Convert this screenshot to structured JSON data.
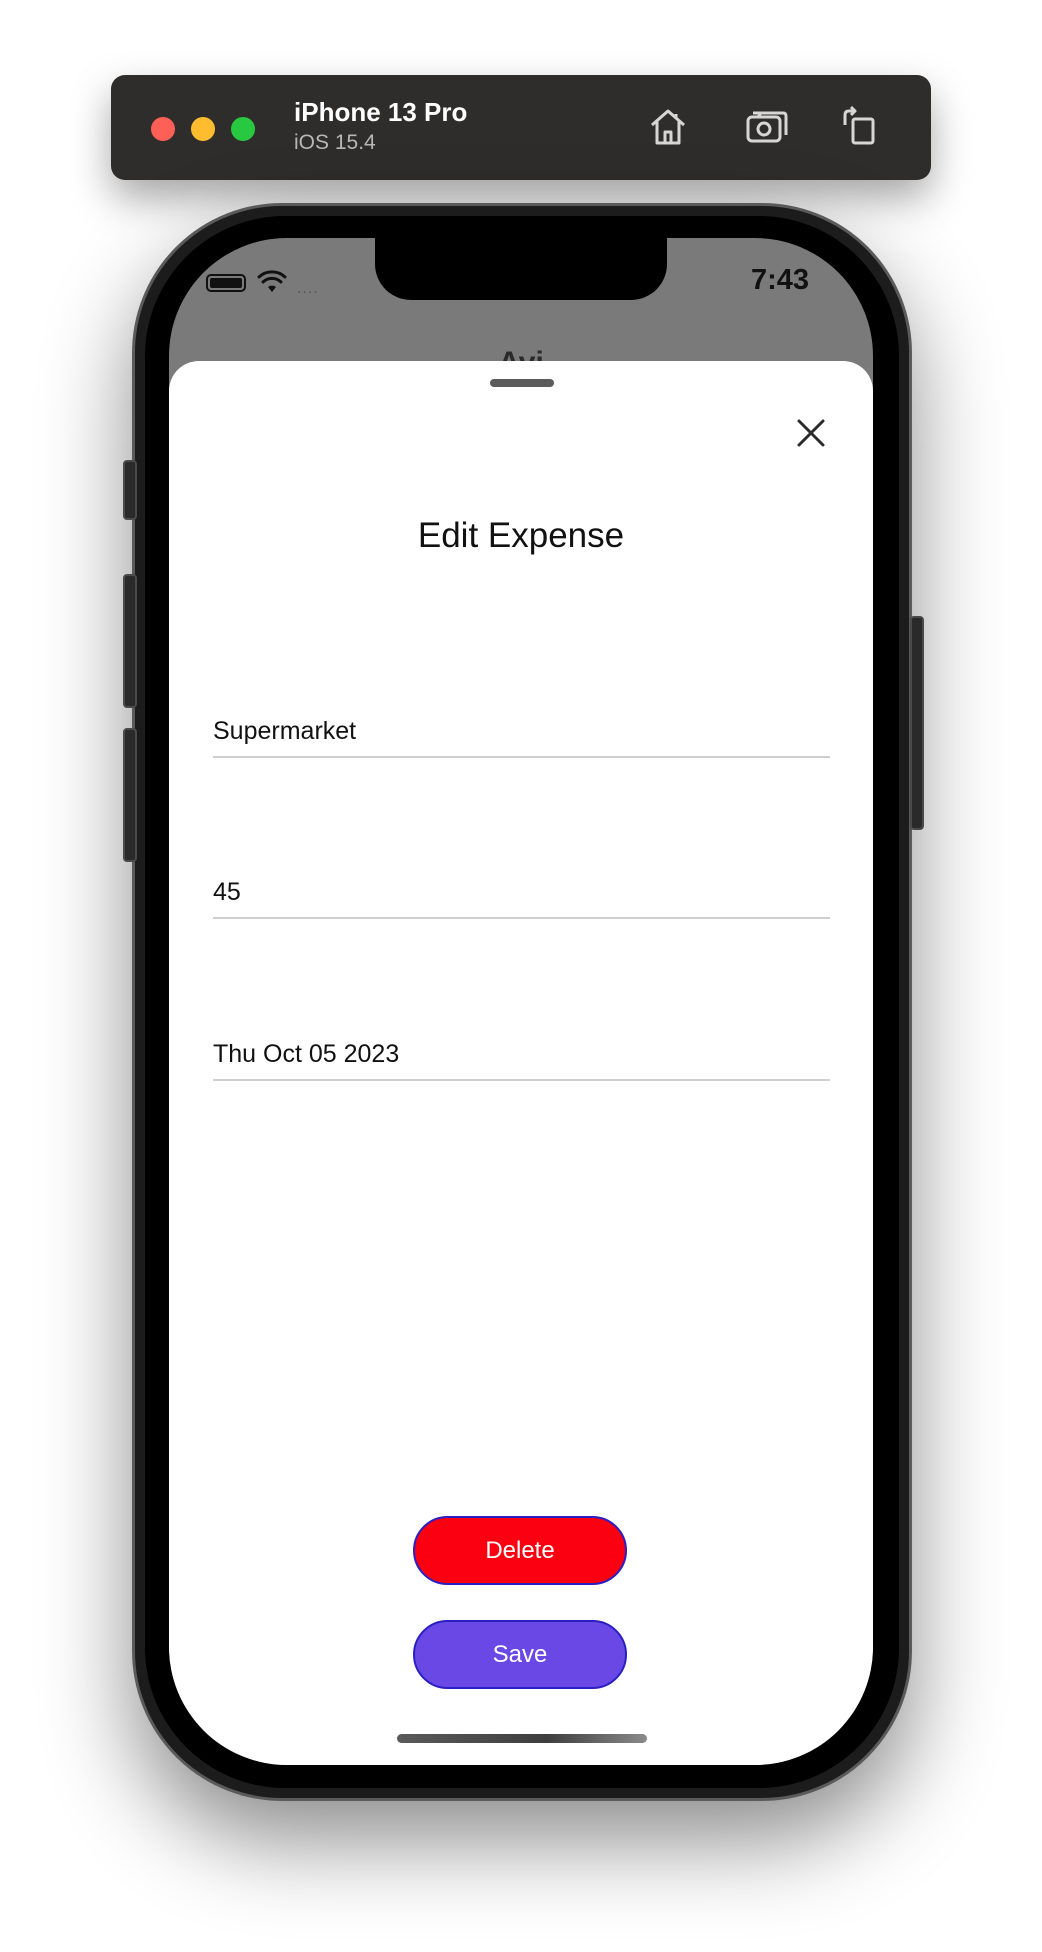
{
  "simulator": {
    "device_name": "iPhone 13 Pro",
    "os_version": "iOS 15.4",
    "toolbar_icons": [
      "home-icon",
      "screenshot-icon",
      "rotate-icon"
    ]
  },
  "status_bar": {
    "time": "7:43",
    "icons": [
      "battery-icon",
      "wifi-icon",
      "signal-icon"
    ]
  },
  "background_screen": {
    "title": "Avi"
  },
  "sheet": {
    "title": "Edit Expense",
    "close_icon": "close-icon",
    "fields": {
      "name": "Supermarket",
      "amount": "45",
      "date": "Thu Oct 05 2023"
    },
    "buttons": {
      "delete_label": "Delete",
      "save_label": "Save"
    }
  },
  "colors": {
    "delete": "#fa0010",
    "save": "#6a48e6",
    "button_border": "#2a1fc2"
  }
}
